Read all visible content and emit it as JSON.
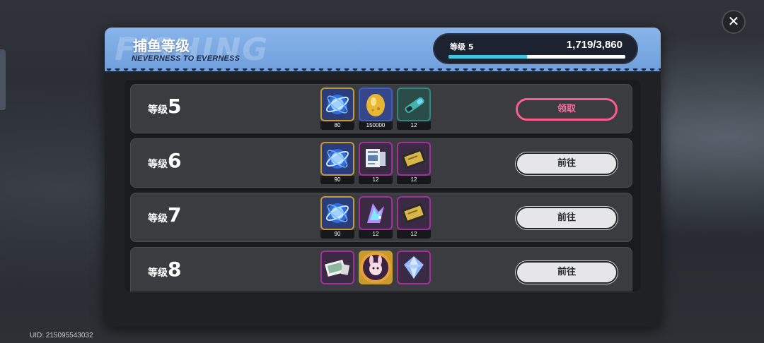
{
  "panel": {
    "title": "捕鱼等级",
    "subtitle": "NEVERNESS TO EVERNESS",
    "watermark": "FISHING"
  },
  "level": {
    "label": "等级 5",
    "progress_text": "1,719/3,860",
    "progress_fraction": 0.445
  },
  "rows": [
    {
      "prefix": "等级",
      "number": "5",
      "button": "领取",
      "button_type": "claim",
      "rewards": [
        {
          "icon": "blue-orb-icon",
          "count": "80"
        },
        {
          "icon": "gold-coin-egg-icon",
          "count": "150000"
        },
        {
          "icon": "teal-scroll-icon",
          "count": "12"
        }
      ]
    },
    {
      "prefix": "等级",
      "number": "6",
      "button": "前往",
      "button_type": "go",
      "rewards": [
        {
          "icon": "blue-orb-icon",
          "count": "90"
        },
        {
          "icon": "card-pack-icon",
          "count": "12"
        },
        {
          "icon": "gold-ticket-icon",
          "count": "12"
        }
      ]
    },
    {
      "prefix": "等级",
      "number": "7",
      "button": "前往",
      "button_type": "go",
      "rewards": [
        {
          "icon": "blue-orb-icon",
          "count": "90"
        },
        {
          "icon": "crystal-feather-icon",
          "count": "12"
        },
        {
          "icon": "gold-ticket-icon",
          "count": "12"
        }
      ]
    },
    {
      "prefix": "等级",
      "number": "8",
      "button": "前往",
      "button_type": "go",
      "rewards": [
        {
          "icon": "photo-card-icon",
          "count": ""
        },
        {
          "icon": "bunny-badge-icon",
          "count": ""
        },
        {
          "icon": "diamond-crystal-icon",
          "count": ""
        }
      ]
    }
  ],
  "uid": "UID: 215095543032",
  "close_label": "✕",
  "colors": {
    "header_blue": "#7aa9e4",
    "progress_cyan": "#3ec6e0",
    "claim_pink": "#ff5b8f",
    "gold_frame": "#c9a23a",
    "blue_frame": "#3f5fb8",
    "teal_frame": "#2e8a80",
    "purple_frame": "#a0329a"
  }
}
